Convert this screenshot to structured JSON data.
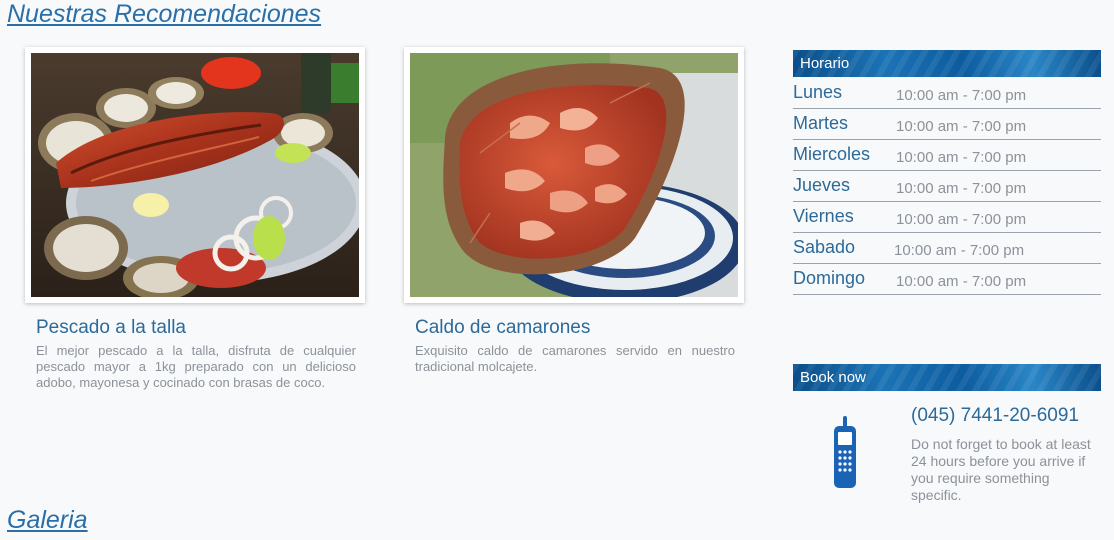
{
  "sections": {
    "recommendations_title": "Nuestras Recomendaciones",
    "gallery_title": "Galeria"
  },
  "cards": [
    {
      "title": "Pescado a la talla",
      "description": "El mejor pescado a la talla, disfruta de cualquier pescado mayor a 1kg preparado con un delicioso adobo, mayonesa y cocinado con brasas de coco."
    },
    {
      "title": "Caldo de camarones",
      "description": "Exquisito caldo de camarones servido en nuestro tradicional molcajete."
    }
  ],
  "schedule": {
    "header": "Horario",
    "rows": [
      {
        "day": "Lunes",
        "hours": "10:00 am - 7:00 pm"
      },
      {
        "day": "Martes",
        "hours": "10:00 am - 7:00 pm"
      },
      {
        "day": "Miercoles",
        "hours": "10:00 am - 7:00 pm"
      },
      {
        "day": "Jueves",
        "hours": "10:00 am - 7:00 pm"
      },
      {
        "day": "Viernes",
        "hours": "10:00 am - 7:00 pm"
      },
      {
        "day": "Sabado",
        "hours": "10:00 am - 7:00 pm"
      },
      {
        "day": "Domingo",
        "hours": "10:00 am - 7:00 pm"
      }
    ]
  },
  "booking": {
    "header": "Book now",
    "phone": "(045) 7441-20-6091",
    "note": "Do not forget to book at least 24 hours before you arrive if you require something specific.",
    "icon": "mobile-phone-icon"
  },
  "colors": {
    "accent": "#2a6fa8",
    "header_blue": "#0c5c9f",
    "muted_text": "#8c9299",
    "background": "#f7f9fb"
  }
}
